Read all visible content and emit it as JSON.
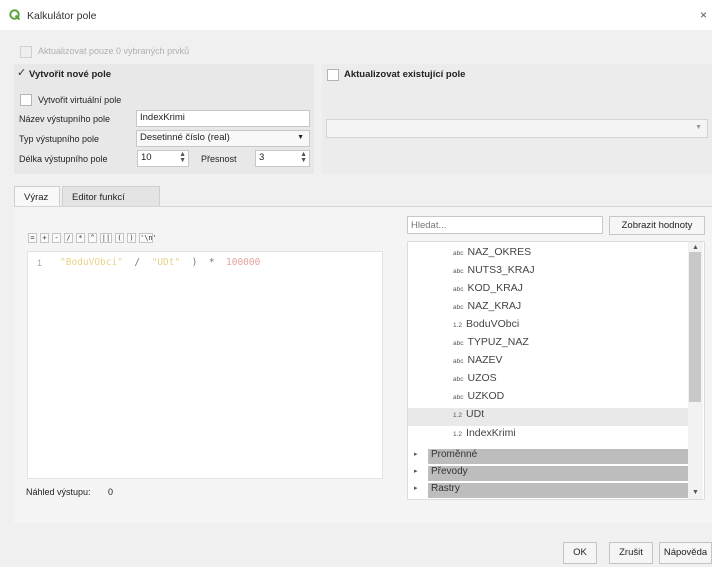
{
  "window": {
    "title": "Kalkulátor pole",
    "close_glyph": "×"
  },
  "update_selected_only": {
    "label": "Aktualizovat pouze 0 vybraných prvků",
    "checked": false,
    "enabled": false
  },
  "create_field": {
    "label": "Vytvořit nové pole",
    "checkmark": "✓",
    "virtual_label": "Vytvořit virtuální pole",
    "name_label": "Název výstupního pole",
    "name_value": "IndexKrimi",
    "type_label": "Typ výstupního pole",
    "type_value": "Desetinné číslo (real)",
    "length_label": "Délka výstupního pole",
    "length_value": "10",
    "precision_label": "Přesnost",
    "precision_value": "3"
  },
  "update_existing": {
    "label": "Aktualizovat existující pole",
    "field_value": ""
  },
  "tabs": [
    {
      "label": "Výraz"
    },
    {
      "label": "Editor funkcí"
    }
  ],
  "operators": [
    "=",
    "+",
    "-",
    "/",
    "*",
    "^",
    "||",
    "(",
    ")",
    "'\\n'"
  ],
  "expression": {
    "line_number": "1",
    "token1": "\"BoduVObci\"",
    "op1": "/",
    "token2": "\"UDt\"",
    "op2": ")",
    "op3": "*",
    "token3": "100000"
  },
  "preview": {
    "label": "Náhled výstupu:",
    "value": "0"
  },
  "search": {
    "placeholder": "Hledat..."
  },
  "show_values_button": "Zobrazit hodnoty",
  "fields": [
    {
      "type": "abc",
      "name": "NAZ_OKRES"
    },
    {
      "type": "abc",
      "name": "NUTS3_KRAJ"
    },
    {
      "type": "abc",
      "name": "KOD_KRAJ"
    },
    {
      "type": "abc",
      "name": "NAZ_KRAJ"
    },
    {
      "type": "1.2",
      "name": "BoduVObci"
    },
    {
      "type": "abc",
      "name": "TYPUZ_NAZ"
    },
    {
      "type": "abc",
      "name": "NAZEV"
    },
    {
      "type": "abc",
      "name": "UZOS"
    },
    {
      "type": "abc",
      "name": "UZKOD"
    },
    {
      "type": "1.2",
      "name": "UDt"
    },
    {
      "type": "1.2",
      "name": "IndexKrimi"
    }
  ],
  "selected_field_index": 9,
  "groups": [
    {
      "label": "Proměnné"
    },
    {
      "label": "Převody"
    },
    {
      "label": "Rastry"
    }
  ],
  "buttons": {
    "ok": "OK",
    "cancel": "Zrušit",
    "help": "Nápověda"
  },
  "colors": {
    "string_token": "#e8d48a",
    "number_token": "#e8a0a0",
    "line_number": "#a8a8a8",
    "qgis_green": "#57a43a",
    "group_bg": "#bdbdbd"
  },
  "icons": {
    "app": "qgis-logo-icon",
    "close": "close-icon",
    "checkmark": "check-icon",
    "expand": "expand-arrow-icon"
  }
}
